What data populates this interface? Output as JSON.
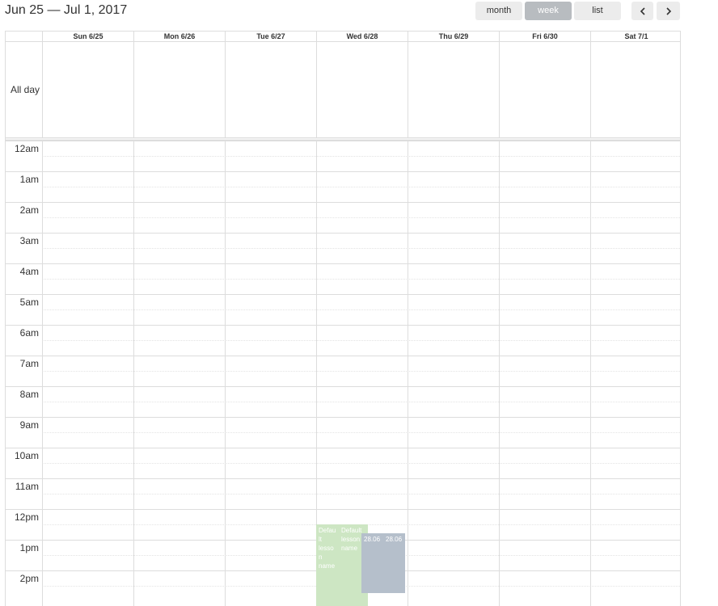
{
  "toolbar": {
    "title": "Jun 25 — Jul 1, 2017",
    "month_label": "month",
    "week_label": "week",
    "list_label": "list",
    "prev_icon": "chevron-left-icon",
    "next_icon": "chevron-right-icon",
    "active_view": "week",
    "active_color": "#b8bcc0"
  },
  "calendar": {
    "days": [
      "Sun 6/25",
      "Mon 6/26",
      "Tue 6/27",
      "Wed 6/28",
      "Thu 6/29",
      "Fri 6/30",
      "Sat 7/1"
    ],
    "allday_label": "All day",
    "hours": [
      "12am",
      "1am",
      "2am",
      "3am",
      "4am",
      "5am",
      "6am",
      "7am",
      "8am",
      "9am",
      "10am",
      "11am",
      "12pm",
      "1pm",
      "2pm"
    ],
    "events": [
      {
        "label": "Default lesson name",
        "color": "#cde6c3",
        "day": "Wed 6/28"
      },
      {
        "label": "Default lesson name",
        "color": "#cde6c3",
        "day": "Wed 6/28"
      },
      {
        "label": "28.06",
        "color": "#b5bfcb",
        "day": "Wed 6/28"
      },
      {
        "label": "28.06",
        "color": "#b5bfcb",
        "day": "Wed 6/28"
      }
    ]
  }
}
